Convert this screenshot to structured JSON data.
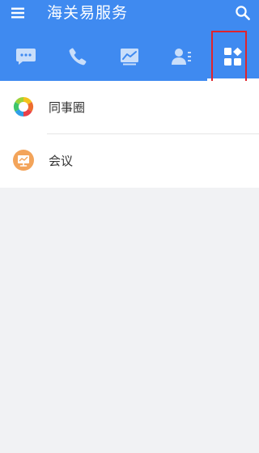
{
  "header": {
    "title": "海关易服务",
    "menu_icon": "menu-icon",
    "search_icon": "search-icon",
    "background_color": "#3f8af0"
  },
  "tabs": [
    {
      "icon": "chat-bubble-icon",
      "active": false
    },
    {
      "icon": "phone-icon",
      "active": false
    },
    {
      "icon": "trend-chart-icon",
      "active": false
    },
    {
      "icon": "contacts-icon",
      "active": false
    },
    {
      "icon": "apps-grid-icon",
      "active": true
    }
  ],
  "highlight_color": "#e0242c",
  "list": {
    "items": [
      {
        "label": "同事圈",
        "icon": "colleague-circle-icon"
      },
      {
        "label": "会议",
        "icon": "meeting-icon"
      }
    ]
  }
}
